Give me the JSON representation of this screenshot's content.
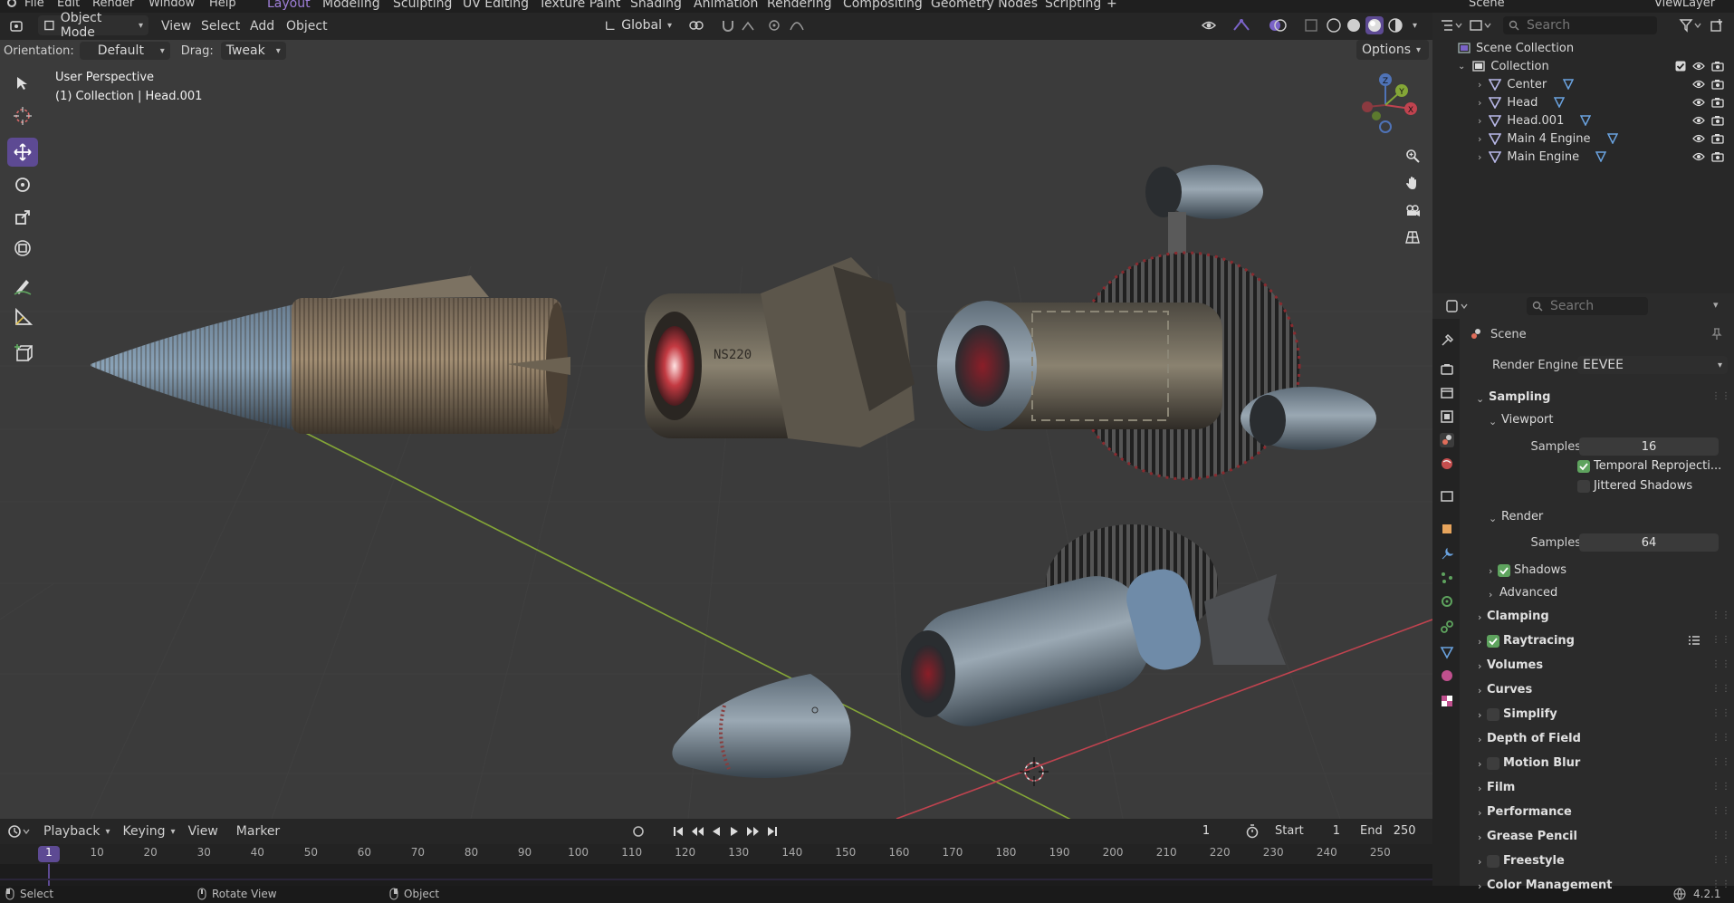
{
  "menu": {
    "items": [
      "File",
      "Edit",
      "Render",
      "Window",
      "Help"
    ]
  },
  "workspaces": [
    "Layout",
    "Modeling",
    "Sculpting",
    "UV Editing",
    "Texture Paint",
    "Shading",
    "Animation",
    "Rendering",
    "Compositing",
    "Geometry Nodes",
    "Scripting"
  ],
  "scene_name": "Scene",
  "view_layer_name": "ViewLayer",
  "viewport_header": {
    "mode": "Object Mode",
    "menus": [
      "View",
      "Select",
      "Add",
      "Object"
    ],
    "transform_orientation": "Global",
    "orientation_label": "Orientation:",
    "orientation_value": "Default",
    "drag_label": "Drag:",
    "drag_value": "Tweak",
    "options_label": "Options"
  },
  "viewport": {
    "perspective_label": "User Perspective",
    "collection_label": "(1) Collection | Head.001",
    "gizmo_axes": {
      "x": "X",
      "y": "Y",
      "z": "Z"
    },
    "model_text": "NS220"
  },
  "outliner": {
    "search_placeholder": "Search",
    "root": "Scene Collection",
    "collection": "Collection",
    "objects": [
      "Center",
      "Head",
      "Head.001",
      "Main 4 Engine",
      "Main Engine"
    ]
  },
  "properties": {
    "search_placeholder": "Search",
    "context": "Scene",
    "render_engine_label": "Render Engine",
    "render_engine_value": "EEVEE",
    "sampling": {
      "title": "Sampling",
      "viewport_title": "Viewport",
      "viewport_samples_label": "Samples",
      "viewport_samples": "16",
      "temporal_reprojection": "Temporal Reprojecti...",
      "temporal_reprojection_checked": true,
      "jittered_shadows": "Jittered Shadows",
      "jittered_shadows_checked": false,
      "render_title": "Render",
      "render_samples_label": "Samples",
      "render_samples": "64",
      "shadows": "Shadows",
      "shadows_checked": true,
      "advanced": "Advanced"
    },
    "sections": [
      {
        "label": "Clamping",
        "checkbox": null
      },
      {
        "label": "Raytracing",
        "checkbox": true
      },
      {
        "label": "Volumes",
        "checkbox": null
      },
      {
        "label": "Curves",
        "checkbox": null
      },
      {
        "label": "Simplify",
        "checkbox": false
      },
      {
        "label": "Depth of Field",
        "checkbox": null
      },
      {
        "label": "Motion Blur",
        "checkbox": false
      },
      {
        "label": "Film",
        "checkbox": null
      },
      {
        "label": "Performance",
        "checkbox": null
      },
      {
        "label": "Grease Pencil",
        "checkbox": null
      },
      {
        "label": "Freestyle",
        "checkbox": false
      },
      {
        "label": "Color Management",
        "checkbox": null
      }
    ]
  },
  "timeline": {
    "menus": [
      "Playback",
      "Keying",
      "View",
      "Marker"
    ],
    "current_frame": "1",
    "start_label": "Start",
    "start": "1",
    "end_label": "End",
    "end": "250",
    "ruler": [
      "1",
      "10",
      "20",
      "30",
      "40",
      "50",
      "60",
      "70",
      "80",
      "90",
      "100",
      "110",
      "120",
      "130",
      "140",
      "150",
      "160",
      "170",
      "180",
      "190",
      "200",
      "210",
      "220",
      "230",
      "240",
      "250"
    ]
  },
  "status_bar": {
    "select": "Select",
    "rotate": "Rotate View",
    "object": "Object",
    "version": "4.2.1"
  },
  "colors": {
    "accent": "#5d4a93",
    "accent_text": "#9f7fd8",
    "checkbox_on": "#5ea35e",
    "x_axis": "#c0434f",
    "y_axis": "#84a637",
    "z_axis": "#4f73b7"
  }
}
